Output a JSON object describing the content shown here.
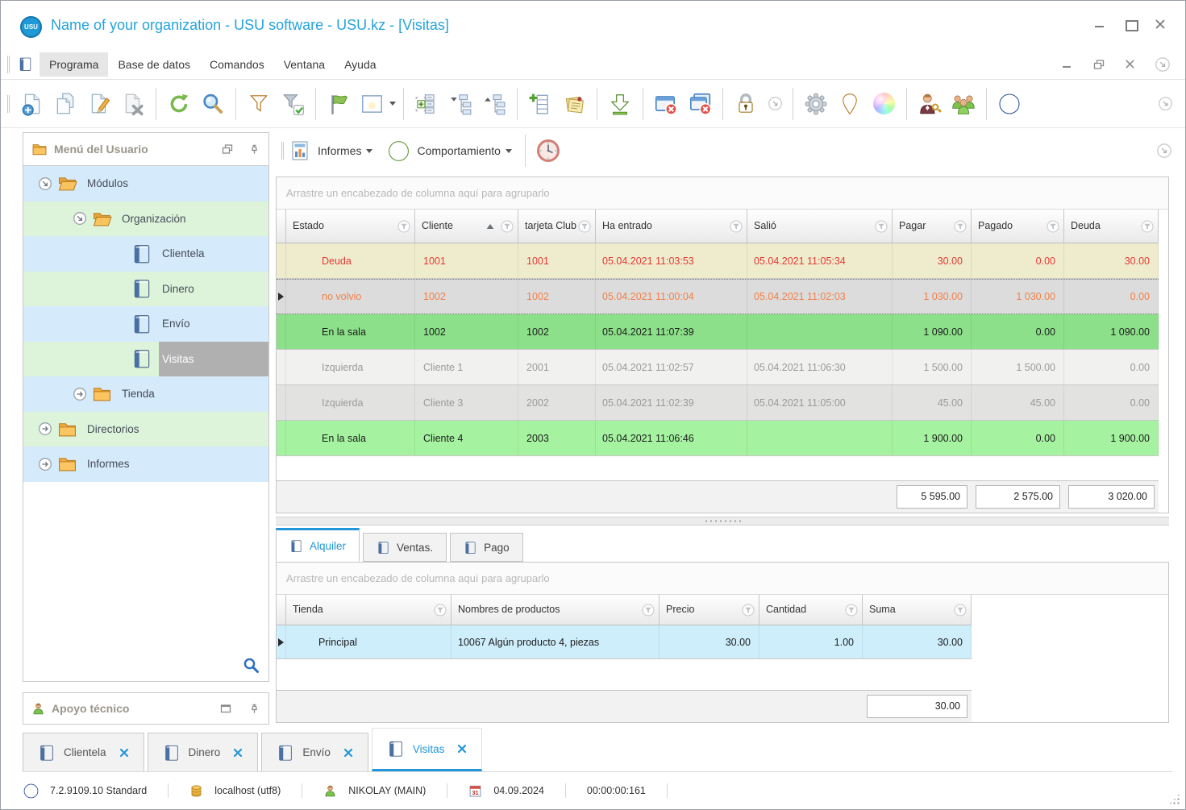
{
  "window": {
    "title": "Name of your organization - USU software - USU.kz - [Visitas]",
    "logo_text": "USU"
  },
  "menubar": {
    "items": [
      "Programa",
      "Base de datos",
      "Comandos",
      "Ventana",
      "Ayuda"
    ]
  },
  "toolbar": {
    "icon_names": [
      "new-document",
      "copy-document",
      "edit-document",
      "delete-document",
      "refresh",
      "search",
      "filter",
      "filter-apply",
      "flag",
      "image-viewer",
      "expand-list",
      "collapse-tree",
      "expand-tree",
      "add-row",
      "notes",
      "export-download",
      "close-window",
      "close-all-windows",
      "lock",
      "overflow-chevron",
      "settings-gear",
      "location-pin",
      "color-wheel",
      "user-permissions",
      "user-group",
      "about-info"
    ]
  },
  "sidebar": {
    "header": {
      "title": "Menú del Usuario"
    },
    "tree": [
      {
        "label": "Módulos"
      },
      {
        "label": "Organización"
      },
      {
        "label": "Clientela"
      },
      {
        "label": "Dinero"
      },
      {
        "label": "Envío"
      },
      {
        "label": "Visitas",
        "selected": true
      },
      {
        "label": "Tienda"
      },
      {
        "label": "Directorios"
      },
      {
        "label": "Informes"
      }
    ],
    "support": {
      "title": "Apoyo técnico"
    }
  },
  "viewbar": {
    "reports_label": "Informes",
    "behavior_label": "Comportamiento"
  },
  "main_grid": {
    "group_hint": "Arrastre un encabezado de columna aquí para agruparlo",
    "columns": [
      "Estado",
      "Cliente",
      "tarjeta Club",
      "Ha entrado",
      "Salió",
      "Pagar",
      "Pagado",
      "Deuda"
    ],
    "rows": [
      {
        "estado": "Deuda",
        "cliente": "1001",
        "tarjeta": "1001",
        "entrada": "05.04.2021 11:03:53",
        "salida": "05.04.2021 11:05:34",
        "pagar": "30.00",
        "pagado": "0.00",
        "deuda": "30.00",
        "style": "debt"
      },
      {
        "estado": "no volvio",
        "cliente": "1002",
        "tarjeta": "1002",
        "entrada": "05.04.2021 11:00:04",
        "salida": "05.04.2021 11:02:03",
        "pagar": "1 030.00",
        "pagado": "1 030.00",
        "deuda": "0.00",
        "style": "no-return-selected"
      },
      {
        "estado": "En la sala",
        "cliente": "1002",
        "tarjeta": "1002",
        "entrada": "05.04.2021 11:07:39",
        "salida": "",
        "pagar": "1 090.00",
        "pagado": "0.00",
        "deuda": "1 090.00",
        "style": "in-hall"
      },
      {
        "estado": "Izquierda",
        "cliente": "Cliente 1",
        "tarjeta": "2001",
        "entrada": "05.04.2021 11:02:57",
        "salida": "05.04.2021 11:06:30",
        "pagar": "1 500.00",
        "pagado": "1 500.00",
        "deuda": "0.00",
        "style": "left"
      },
      {
        "estado": "Izquierda",
        "cliente": "Cliente 3",
        "tarjeta": "2002",
        "entrada": "05.04.2021 11:02:39",
        "salida": "05.04.2021 11:05:00",
        "pagar": "45.00",
        "pagado": "45.00",
        "deuda": "0.00",
        "style": "left"
      },
      {
        "estado": "En la sala",
        "cliente": "Cliente 4",
        "tarjeta": "2003",
        "entrada": "05.04.2021 11:06:46",
        "salida": "",
        "pagar": "1 900.00",
        "pagado": "0.00",
        "deuda": "1 900.00",
        "style": "in-hall"
      }
    ],
    "totals": {
      "pagar": "5 595.00",
      "pagado": "2 575.00",
      "deuda": "3 020.00"
    }
  },
  "detail": {
    "tabs": [
      {
        "label": "Alquiler",
        "active": true
      },
      {
        "label": "Ventas."
      },
      {
        "label": "Pago"
      }
    ],
    "grid": {
      "group_hint": "Arrastre un encabezado de columna aquí para agruparlo",
      "columns": [
        "Tienda",
        "Nombres de productos",
        "Precio",
        "Cantidad",
        "Suma"
      ],
      "rows": [
        {
          "tienda": "Principal",
          "producto": "10067 Algún producto 4, piezas",
          "precio": "30.00",
          "cantidad": "1.00",
          "suma": "30.00"
        }
      ],
      "totals": {
        "suma": "30.00"
      }
    }
  },
  "mdi_tabs": [
    {
      "label": "Clientela"
    },
    {
      "label": "Dinero"
    },
    {
      "label": "Envío"
    },
    {
      "label": "Visitas",
      "active": true
    }
  ],
  "statusbar": {
    "version": "7.2.9109.10 Standard",
    "database": "localhost (utf8)",
    "user": "NIKOLAY (MAIN)",
    "calendar_day": "31",
    "date": "04.09.2024",
    "timer": "00:00:00:161"
  },
  "colors": {
    "title_blue": "#25a3dd",
    "accent_blue": "#2196d9",
    "sidebar_stripe_blue": "#d5eafa",
    "sidebar_stripe_green": "#def4da",
    "selected_gray": "#b0b0b0",
    "row_debt_bg": "#eeeccd",
    "row_debt_text": "#e53935",
    "row_no_return_bg": "#dcdcdc",
    "row_no_return_text": "#f28048",
    "row_in_hall_bg_1": "#8ce089",
    "row_in_hall_bg_2": "#a5f3a0",
    "row_left_text": "#9a9a9a",
    "detail_row_bg": "#cfeefc"
  }
}
